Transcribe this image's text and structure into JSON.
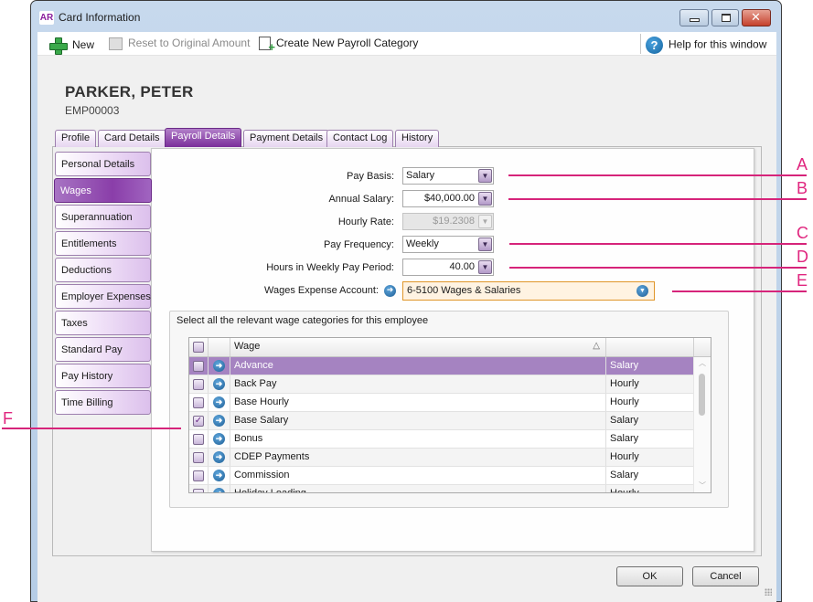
{
  "window": {
    "app_logo": "AR",
    "title": "Card Information",
    "controls": {
      "minimize_icon": "minimize-icon",
      "maximize_icon": "maximize-icon",
      "close_label": "✕"
    }
  },
  "toolbar": {
    "new_label": "New",
    "reset_label": "Reset to Original Amount",
    "create_label": "Create New Payroll Category",
    "help_label": "Help for this window",
    "help_glyph": "?"
  },
  "employee": {
    "name": "PARKER, PETER",
    "id": "EMP00003"
  },
  "tabs": [
    {
      "label": "Profile",
      "active": false
    },
    {
      "label": "Card Details",
      "active": false
    },
    {
      "label": "Payroll Details",
      "active": true
    },
    {
      "label": "Payment Details",
      "active": false
    },
    {
      "label": "Contact Log",
      "active": false
    },
    {
      "label": "History",
      "active": false
    }
  ],
  "subnav": [
    {
      "label": "Personal Details",
      "active": false
    },
    {
      "label": "Wages",
      "active": true
    },
    {
      "label": "Superannuation",
      "active": false
    },
    {
      "label": "Entitlements",
      "active": false
    },
    {
      "label": "Deductions",
      "active": false
    },
    {
      "label": "Employer Expenses",
      "active": false
    },
    {
      "label": "Taxes",
      "active": false
    },
    {
      "label": "Standard Pay",
      "active": false
    },
    {
      "label": "Pay History",
      "active": false
    },
    {
      "label": "Time Billing",
      "active": false
    }
  ],
  "form": {
    "pay_basis": {
      "label": "Pay Basis:",
      "value": "Salary"
    },
    "annual_salary": {
      "label": "Annual Salary:",
      "value": "$40,000.00"
    },
    "hourly_rate": {
      "label": "Hourly Rate:",
      "value": "$19.2308",
      "disabled": true
    },
    "pay_frequency": {
      "label": "Pay Frequency:",
      "value": "Weekly"
    },
    "hours_per_period": {
      "label": "Hours in Weekly Pay Period:",
      "value": "40.00"
    },
    "expense_account": {
      "label": "Wages Expense Account:",
      "value": "6-5100 Wages & Salaries"
    }
  },
  "wage_group": {
    "title": "Select all the relevant wage categories for this employee",
    "columns": {
      "wage": "Wage",
      "type": "",
      "sort_glyph": "△"
    },
    "rows": [
      {
        "name": "Advance",
        "type": "Salary",
        "checked": false,
        "selected": true
      },
      {
        "name": "Back Pay",
        "type": "Hourly",
        "checked": false,
        "selected": false
      },
      {
        "name": "Base Hourly",
        "type": "Hourly",
        "checked": false,
        "selected": false
      },
      {
        "name": "Base Salary",
        "type": "Salary",
        "checked": true,
        "selected": false
      },
      {
        "name": "Bonus",
        "type": "Salary",
        "checked": false,
        "selected": false
      },
      {
        "name": "CDEP Payments",
        "type": "Hourly",
        "checked": false,
        "selected": false
      },
      {
        "name": "Commission",
        "type": "Salary",
        "checked": false,
        "selected": false
      },
      {
        "name": "Holiday Loading",
        "type": "Hourly",
        "checked": false,
        "selected": false
      }
    ]
  },
  "buttons": {
    "ok": "OK",
    "cancel": "Cancel"
  },
  "callouts": [
    "A",
    "B",
    "C",
    "D",
    "E",
    "F"
  ],
  "colors": {
    "accent_purple": "#7a2e9a",
    "selected_row": "#a583c1",
    "callout": "#d6247a",
    "account_field": "#fff3e2"
  }
}
